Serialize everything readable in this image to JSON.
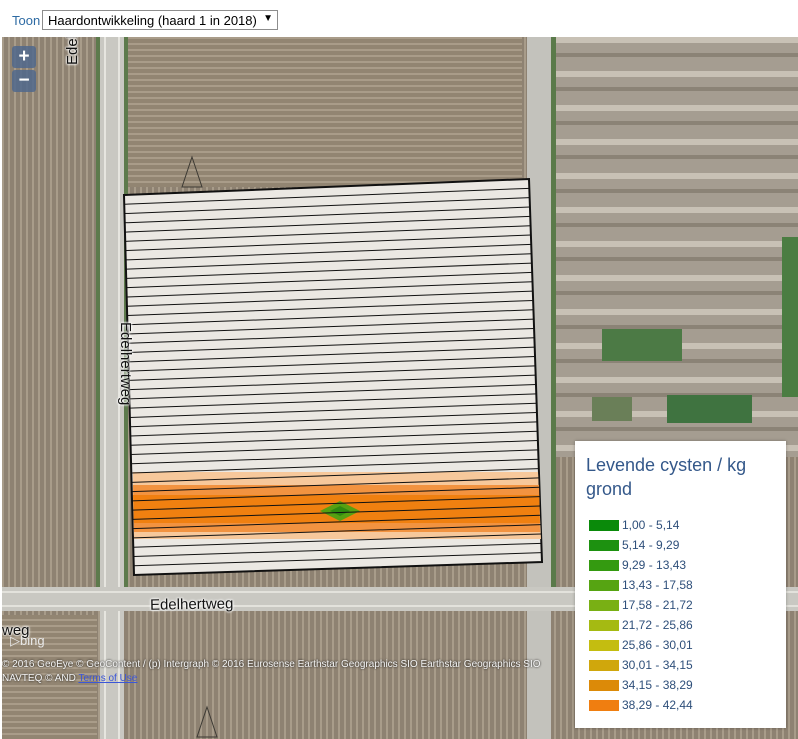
{
  "toolbar": {
    "label": "Toon",
    "selected_layer": "Haardontwikkeling (haard 1 in 2018)"
  },
  "map": {
    "zoom_in": "+",
    "zoom_out": "−",
    "roads": {
      "vertical_top": "Edelhertweg",
      "vertical_middle": "Edelhertweg",
      "horizontal": "Edelhertweg",
      "edge_left": "weg"
    },
    "bing_logo": "bing",
    "attribution_line1": "© 2016 GeoEye © GeoContent / (p) Intergraph © 2016 Eurosense Earthstar Geographics SIO Earthstar Geographics SIO",
    "attribution_line2": "NAVTEQ © AND ",
    "terms_link": "Terms of Use"
  },
  "legend": {
    "title": "Levende cysten / kg grond",
    "items": [
      {
        "label": "1,00 - 5,14",
        "color": "#0a8a0a"
      },
      {
        "label": "5,14 - 9,29",
        "color": "#1d9110"
      },
      {
        "label": "9,29 - 13,43",
        "color": "#349a10"
      },
      {
        "label": "13,43 - 17,58",
        "color": "#56a412"
      },
      {
        "label": "17,58 - 21,72",
        "color": "#79b014"
      },
      {
        "label": "21,72 - 25,86",
        "color": "#a5ba12"
      },
      {
        "label": "25,86 - 30,01",
        "color": "#c4bd10"
      },
      {
        "label": "30,01 - 34,15",
        "color": "#d0a70c"
      },
      {
        "label": "34,15 - 38,29",
        "color": "#dc8a08"
      },
      {
        "label": "38,29 - 42,44",
        "color": "#f07e10"
      }
    ]
  }
}
